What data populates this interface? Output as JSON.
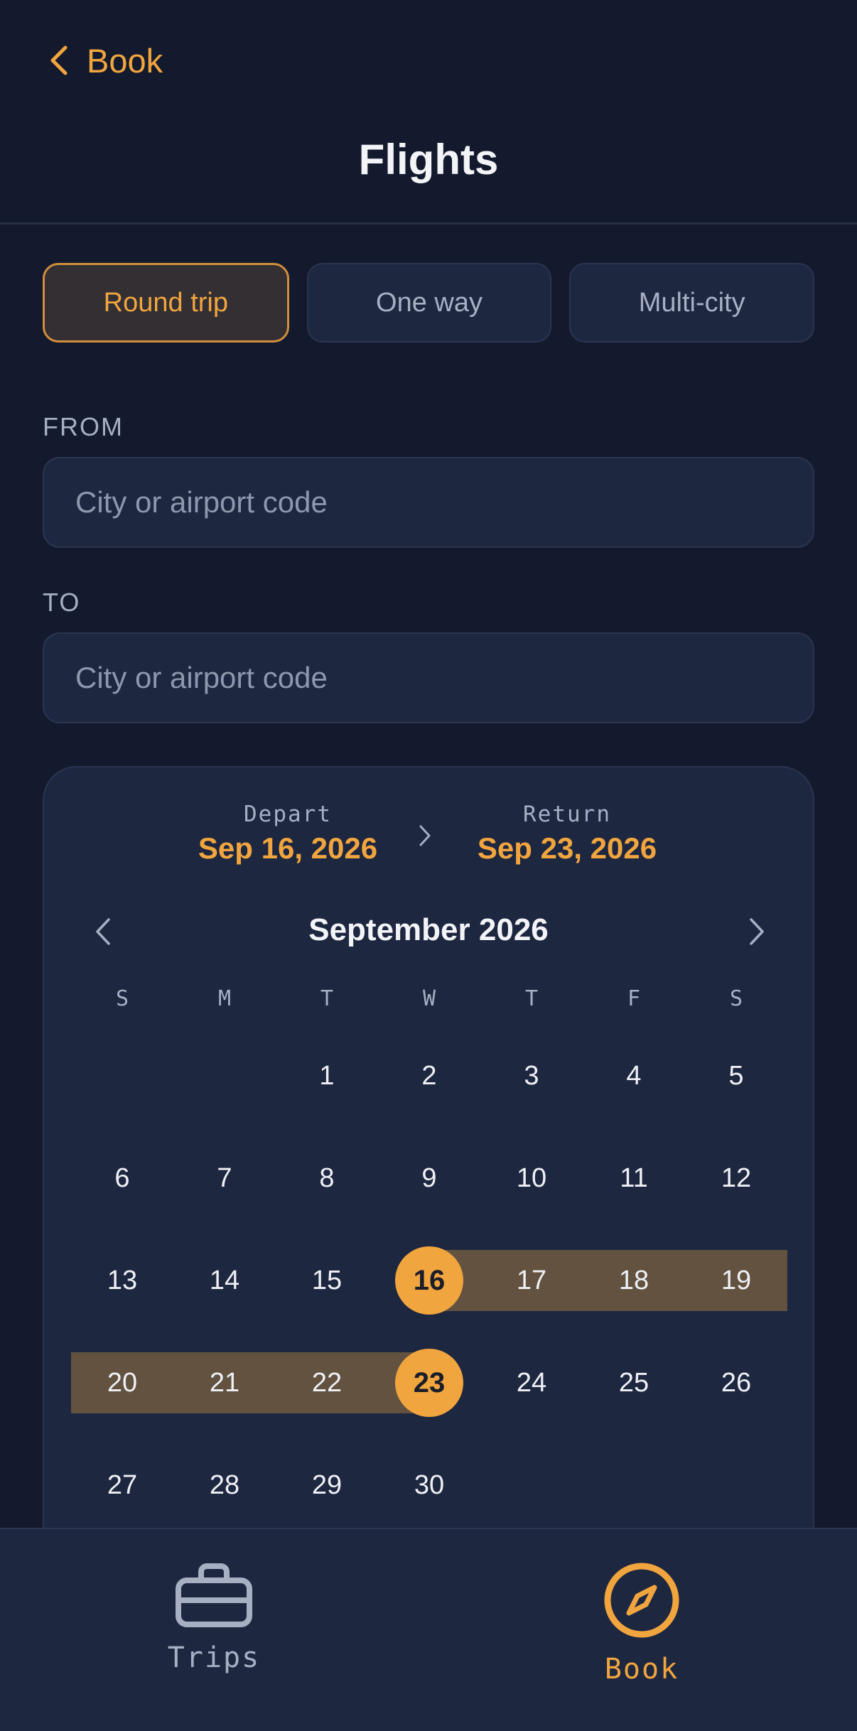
{
  "header": {
    "back_label": "Book",
    "title": "Flights"
  },
  "trip_types": {
    "options": [
      "Round trip",
      "One way",
      "Multi-city"
    ],
    "selected": "Round trip"
  },
  "from": {
    "label": "FROM",
    "placeholder": "City or airport code",
    "value": ""
  },
  "to": {
    "label": "TO",
    "placeholder": "City or airport code",
    "value": ""
  },
  "calendar": {
    "depart_label": "Depart",
    "depart_value": "Sep 16, 2026",
    "return_label": "Return",
    "return_value": "Sep 23, 2026",
    "month_title": "September 2026",
    "weekdays": [
      "S",
      "M",
      "T",
      "W",
      "T",
      "F",
      "S"
    ],
    "start_weekday_index": 2,
    "days_in_month": 30,
    "range_start": 16,
    "range_end": 23
  },
  "tabbar": {
    "items": [
      {
        "label": "Trips",
        "icon": "briefcase-icon",
        "active": false
      },
      {
        "label": "Book",
        "icon": "compass-icon",
        "active": true
      }
    ]
  },
  "colors": {
    "accent": "#f1a53e",
    "background": "#141a2d",
    "surface": "#1e2740",
    "range_fill": "#62523f",
    "muted_text": "#a7afc3"
  }
}
